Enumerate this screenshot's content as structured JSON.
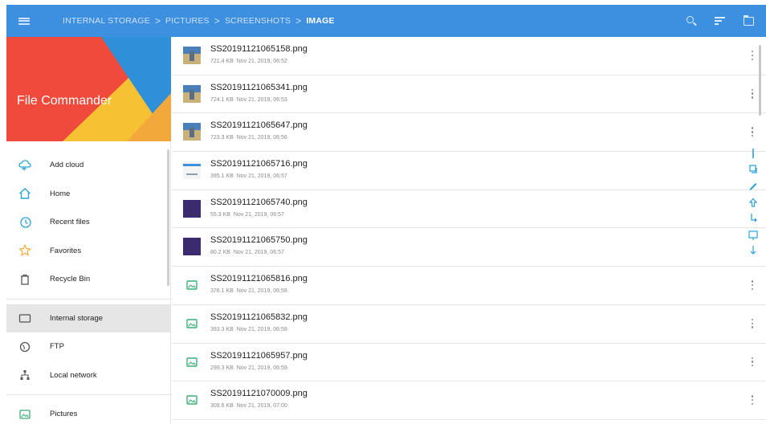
{
  "app": {
    "title": "File Commander"
  },
  "breadcrumb": [
    {
      "label": "INTERNAL STORAGE"
    },
    {
      "label": "PICTURES"
    },
    {
      "label": "SCREENSHOTS"
    },
    {
      "label": "IMAGE"
    }
  ],
  "breadcrumb_separator": ">",
  "appbar_icons": [
    "menu-icon",
    "search-icon",
    "sort-icon",
    "folder-icon"
  ],
  "sidebar": {
    "items": [
      {
        "label": "Add cloud",
        "icon": "cloud-add-icon"
      },
      {
        "label": "Home",
        "icon": "home-icon"
      },
      {
        "label": "Recent files",
        "icon": "recent-icon"
      },
      {
        "label": "Favorites",
        "icon": "star-icon"
      },
      {
        "label": "Recycle Bin",
        "icon": "trash-icon"
      },
      {
        "label": "Internal storage",
        "icon": "storage-icon",
        "selected": true
      },
      {
        "label": "FTP",
        "icon": "ftp-icon"
      },
      {
        "label": "Local network",
        "icon": "network-icon"
      },
      {
        "label": "Pictures",
        "icon": "image-icon"
      }
    ]
  },
  "files": [
    {
      "name": "SS20191121065158.png",
      "size": "721.4 KB",
      "date": "Nov 21, 2019, 06:52",
      "thumb": "photo"
    },
    {
      "name": "SS20191121065341.png",
      "size": "724.1 KB",
      "date": "Nov 21, 2019, 06:53",
      "thumb": "photo"
    },
    {
      "name": "SS20191121065647.png",
      "size": "723.3 KB",
      "date": "Nov 21, 2019, 06:56",
      "thumb": "photo"
    },
    {
      "name": "SS20191121065716.png",
      "size": "395.1 KB",
      "date": "Nov 21, 2019, 06:57",
      "thumb": "doc"
    },
    {
      "name": "SS20191121065740.png",
      "size": "55.3 KB",
      "date": "Nov 21, 2019, 06:57",
      "thumb": "dark"
    },
    {
      "name": "SS20191121065750.png",
      "size": "80.2 KB",
      "date": "Nov 21, 2019, 06:57",
      "thumb": "dark"
    },
    {
      "name": "SS20191121065816.png",
      "size": "376.1 KB",
      "date": "Nov 21, 2019, 06:58",
      "thumb": "image-icon"
    },
    {
      "name": "SS20191121065832.png",
      "size": "393.3 KB",
      "date": "Nov 21, 2019, 06:58",
      "thumb": "image-icon"
    },
    {
      "name": "SS20191121065957.png",
      "size": "299.3 KB",
      "date": "Nov 21, 2019, 06:59",
      "thumb": "image-icon"
    },
    {
      "name": "SS20191121070009.png",
      "size": "309.6 KB",
      "date": "Nov 21, 2019, 07:00",
      "thumb": "image-icon"
    }
  ],
  "more_menu_rows": [
    0,
    1,
    2,
    6,
    7,
    8,
    9
  ],
  "action_strip_icons": [
    "select-all-icon",
    "copy-icon",
    "rename-icon",
    "share-icon",
    "move-icon",
    "info-icon"
  ],
  "colors": {
    "appbar": "#3d8fe0",
    "accent": "#2aa3d8",
    "header_red": "#ef4a3b",
    "header_yellow": "#f7c134",
    "header_blue": "#2f8fd8",
    "image_icon_green": "#3fae7a",
    "dark_thumb": "#3b2a6e"
  }
}
